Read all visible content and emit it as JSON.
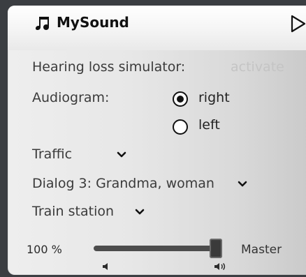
{
  "app": {
    "title": "MySound"
  },
  "hearing_loss": {
    "label": "Hearing loss simulator:",
    "action": "activate"
  },
  "audiogram": {
    "label": "Audiogram:",
    "options": [
      {
        "label": "right",
        "selected": true
      },
      {
        "label": "left",
        "selected": false
      }
    ]
  },
  "dropdowns": [
    {
      "value": "Traffic"
    },
    {
      "value": "Dialog 3: Grandma, woman"
    },
    {
      "value": "Train station"
    }
  ],
  "volume": {
    "readout": "100 %",
    "label": "Master",
    "level_percent": 100
  },
  "icons": {
    "app": "music-note-icon",
    "play": "play-icon",
    "dropdown": "chevron-down-icon",
    "volume_low": "speaker-low-icon",
    "volume_high": "speaker-high-icon"
  },
  "colors": {
    "text": "#3b3b3b",
    "muted": "#c4c4c4",
    "accent_dark": "#111111",
    "slider_fill": "#4c4c4c"
  }
}
